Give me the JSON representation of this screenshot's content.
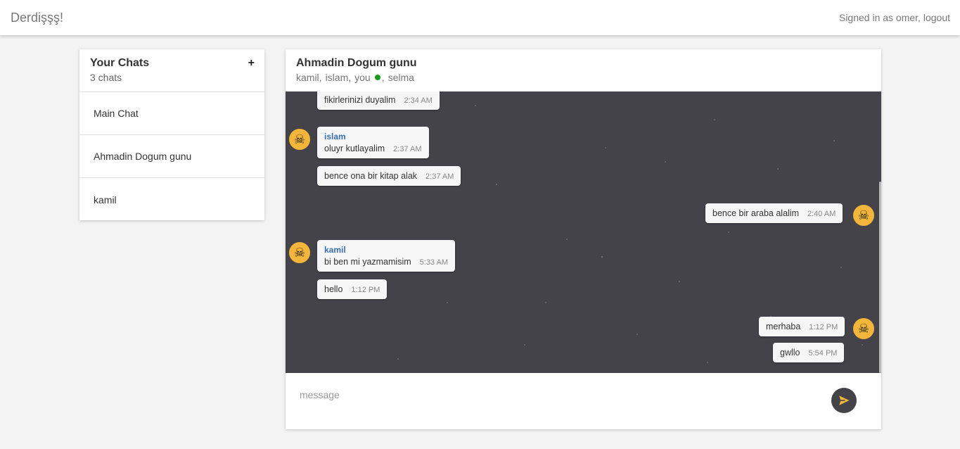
{
  "app": {
    "brand": "Derdişşş!"
  },
  "topbar": {
    "signed_in_text": "Signed in as omer,",
    "logout_label": "logout"
  },
  "sidebar": {
    "title": "Your Chats",
    "count": "3 chats",
    "add_label": "+",
    "items": [
      {
        "label": "Main Chat"
      },
      {
        "label": "Ahmadin Dogum gunu"
      },
      {
        "label": "kamil"
      }
    ]
  },
  "conversation": {
    "title": "Ahmadin Dogum gunu",
    "members": [
      "kamil",
      "islam",
      "you",
      "selma"
    ],
    "online_member": "you",
    "online_color": "#1a9a1a",
    "messages": [
      {
        "text": "fikirlerinizi duyalim",
        "time": "2:34 AM",
        "side": "left"
      },
      {
        "sender": "islam",
        "text": "oluyr kutlayalim",
        "time": "2:37 AM",
        "side": "left",
        "avatar": "skull-icon"
      },
      {
        "text": "bence ona bir kitap alak",
        "time": "2:37 AM",
        "side": "left"
      },
      {
        "text": "bence bir araba alalim",
        "time": "2:40 AM",
        "side": "right",
        "avatar": "skull-icon"
      },
      {
        "sender": "kamil",
        "text": "bi ben mi yazmamisim",
        "time": "5:33 AM",
        "side": "left",
        "avatar": "skull-icon"
      },
      {
        "text": "hello",
        "time": "1:12 PM",
        "side": "left"
      },
      {
        "text": "merhaba",
        "time": "1:12 PM",
        "side": "right",
        "avatar": "skull-icon"
      },
      {
        "text": "gwllo",
        "time": "5:54 PM",
        "side": "right"
      }
    ]
  },
  "composer": {
    "placeholder": "message",
    "send_icon": "send-icon"
  },
  "colors": {
    "chat_bg": "#45434a",
    "avatar": "#f3b53a",
    "sender": "#3c6fb0"
  }
}
